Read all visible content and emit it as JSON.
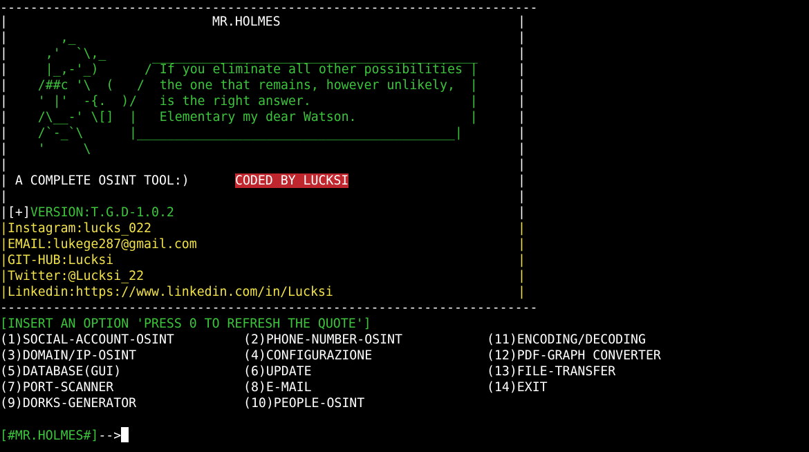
{
  "banner": {
    "top_rule": "-----------------------------------------------------------------------",
    "bottom_rule": "-----------------------------------------------------------------------",
    "border": "|",
    "title": "MR.HOLMES",
    "art_lines": [
      "       ,_",
      "     ,'  `\\,_",
      "     |_,-'_)",
      "    /##c '\\  (",
      "    ' |'  -{.  )",
      "    /\\__-' \\[]",
      "    /`-_`\\",
      "    '     \\"
    ],
    "quote_top": "___________________________________________",
    "quote_lines": [
      "/ If you eliminate all other possibilities |",
      "/  the one that remains, however unlikely,  |",
      "/   is the right answer.                     |",
      "|   Elementary my dear Watson.               |"
    ],
    "quote_bottom": "|__________________________________________|",
    "tagline": " A COMPLETE OSINT TOOL:)",
    "coded_by": "CODED BY LUCKSI",
    "version_prefix": "[+]",
    "version": "VERSION:T.G.D-1.0.2",
    "contacts": [
      "Instagram:lucks_022",
      "EMAIL:lukege287@gmail.com",
      "GIT-HUB:Lucksi",
      "Twitter:@Lucksi_22",
      "Linkedin:https://www.linkedin.com/in/Lucksi"
    ]
  },
  "instruction": "[INSERT AN OPTION 'PRESS 0 TO REFRESH THE QUOTE']",
  "menu": {
    "col1": [
      "(1)SOCIAL-ACCOUNT-OSINT",
      "(3)DOMAIN/IP-OSINT",
      "(5)DATABASE(GUI)",
      "(7)PORT-SCANNER",
      "(9)DORKS-GENERATOR"
    ],
    "col2": [
      "(2)PHONE-NUMBER-OSINT",
      "(4)CONFIGURAZIONE",
      "(6)UPDATE",
      "(8)E-MAIL",
      "(10)PEOPLE-OSINT"
    ],
    "col3": [
      "(11)ENCODING/DECODING",
      "(12)PDF-GRAPH CONVERTER",
      "(13)FILE-TRANSFER",
      "(14)EXIT"
    ]
  },
  "prompt": {
    "label": "[#MR.HOLMES#]",
    "arrow": "-->"
  },
  "colors": {
    "background": "#000000",
    "green": "#3cc43c",
    "yellow": "#f2e34a",
    "red_highlight": "#c0262d"
  }
}
